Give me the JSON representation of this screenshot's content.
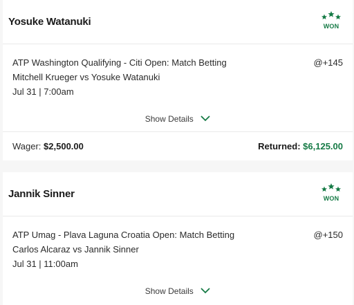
{
  "colors": {
    "won_green": "#157a45",
    "text_dark": "#1a1a1a",
    "divider": "#e9e9e9",
    "background": "#f6f6f6"
  },
  "bets": [
    {
      "selection": "Yosuke Watanuki",
      "status": "WON",
      "status_icon": "three-stars-icon",
      "market": "ATP Washington Qualifying - Citi Open: Match Betting",
      "matchup": "Mitchell Krueger vs Yosuke Watanuki",
      "datetime": "Jul 31 | 7:00am",
      "odds": "@+145",
      "details_label": "Show Details",
      "wager_label": "Wager:",
      "wager_amount": "$2,500.00",
      "returned_label": "Returned:",
      "returned_amount": "$6,125.00"
    },
    {
      "selection": "Jannik Sinner",
      "status": "WON",
      "status_icon": "three-stars-icon",
      "market": "ATP Umag - Plava Laguna Croatia Open: Match Betting",
      "matchup": "Carlos Alcaraz vs Jannik Sinner",
      "datetime": "Jul 31 | 11:00am",
      "odds": "@+150",
      "details_label": "Show Details"
    }
  ]
}
